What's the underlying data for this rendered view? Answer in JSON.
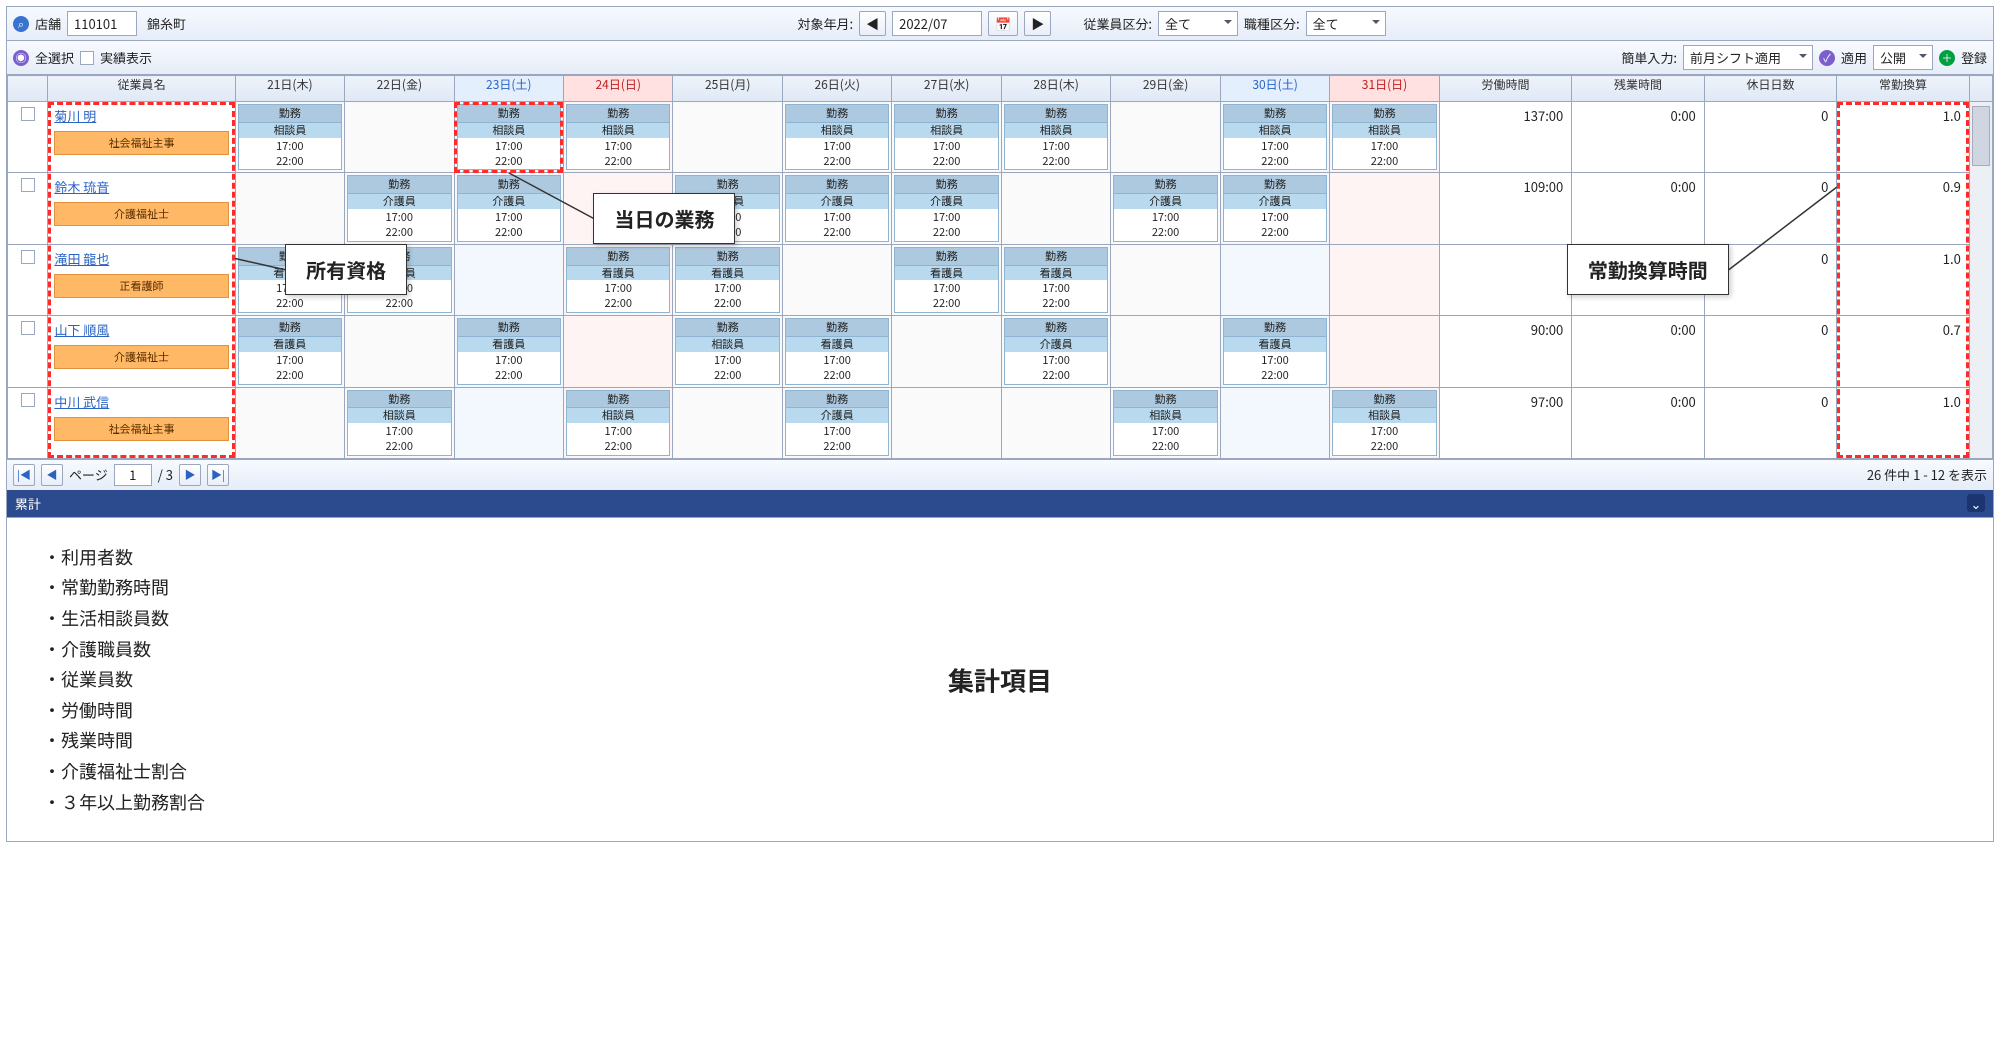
{
  "toolbar1": {
    "store_label": "店舗",
    "store_code": "110101",
    "store_name": "錦糸町",
    "date_label": "対象年月:",
    "date_value": "2022/07",
    "emp_cat_label": "従業員区分:",
    "emp_cat_value": "全て",
    "job_cat_label": "職種区分:",
    "job_cat_value": "全て"
  },
  "toolbar2": {
    "select_all": "全選択",
    "show_actual": "実績表示",
    "easy_label": "簡単入力:",
    "easy_value": "前月シフト適用",
    "apply": "適用",
    "publish": "公開",
    "register": "登録"
  },
  "headers": {
    "emp": "従業員名",
    "work": "労働時間",
    "ot": "残業時間",
    "hol": "休日日数",
    "conv": "常勤換算",
    "days": [
      {
        "l": "21日(木)",
        "c": ""
      },
      {
        "l": "22日(金)",
        "c": ""
      },
      {
        "l": "23日(土)",
        "c": "sat"
      },
      {
        "l": "24日(日)",
        "c": "sun"
      },
      {
        "l": "25日(月)",
        "c": ""
      },
      {
        "l": "26日(火)",
        "c": ""
      },
      {
        "l": "27日(水)",
        "c": ""
      },
      {
        "l": "28日(木)",
        "c": ""
      },
      {
        "l": "29日(金)",
        "c": ""
      },
      {
        "l": "30日(土)",
        "c": "sat"
      },
      {
        "l": "31日(日)",
        "c": "sun"
      }
    ]
  },
  "rows": [
    {
      "name": "菊川 明",
      "qual": "社会福祉主事",
      "work": "137:00",
      "ot": "0:00",
      "hol": "0",
      "conv": "1.0",
      "cells": [
        {
          "h": "勤務",
          "r": "相談員",
          "t1": "17:00",
          "t2": "22:00"
        },
        null,
        {
          "h": "勤務",
          "r": "相談員",
          "t1": "17:00",
          "t2": "22:00"
        },
        {
          "h": "勤務",
          "r": "相談員",
          "t1": "17:00",
          "t2": "22:00"
        },
        null,
        {
          "h": "勤務",
          "r": "相談員",
          "t1": "17:00",
          "t2": "22:00"
        },
        {
          "h": "勤務",
          "r": "相談員",
          "t1": "17:00",
          "t2": "22:00"
        },
        {
          "h": "勤務",
          "r": "相談員",
          "t1": "17:00",
          "t2": "22:00"
        },
        null,
        {
          "h": "勤務",
          "r": "相談員",
          "t1": "17:00",
          "t2": "22:00"
        },
        {
          "h": "勤務",
          "r": "相談員",
          "t1": "17:00",
          "t2": "22:00"
        }
      ]
    },
    {
      "name": "鈴木 琉音",
      "qual": "介護福祉士",
      "work": "109:00",
      "ot": "0:00",
      "hol": "0",
      "conv": "0.9",
      "cells": [
        null,
        {
          "h": "勤務",
          "r": "介護員",
          "t1": "17:00",
          "t2": "22:00"
        },
        {
          "h": "勤務",
          "r": "介護員",
          "t1": "17:00",
          "t2": "22:00"
        },
        null,
        {
          "h": "勤務",
          "r": "介護員",
          "t1": "17:00",
          "t2": "22:00"
        },
        {
          "h": "勤務",
          "r": "介護員",
          "t1": "17:00",
          "t2": "22:00"
        },
        {
          "h": "勤務",
          "r": "介護員",
          "t1": "17:00",
          "t2": "22:00"
        },
        null,
        {
          "h": "勤務",
          "r": "介護員",
          "t1": "17:00",
          "t2": "22:00"
        },
        {
          "h": "勤務",
          "r": "介護員",
          "t1": "17:00",
          "t2": "22:00"
        },
        null
      ]
    },
    {
      "name": "滝田 龍也",
      "qual": "正看護師",
      "work": "",
      "ot": "",
      "hol": "0",
      "conv": "1.0",
      "cells": [
        {
          "h": "勤務",
          "r": "看護員",
          "t1": "17:00",
          "t2": "22:00"
        },
        {
          "h": "勤務",
          "r": "看護員",
          "t1": "17:00",
          "t2": "22:00"
        },
        null,
        {
          "h": "勤務",
          "r": "看護員",
          "t1": "17:00",
          "t2": "22:00"
        },
        {
          "h": "勤務",
          "r": "看護員",
          "t1": "17:00",
          "t2": "22:00"
        },
        null,
        {
          "h": "勤務",
          "r": "看護員",
          "t1": "17:00",
          "t2": "22:00"
        },
        {
          "h": "勤務",
          "r": "看護員",
          "t1": "17:00",
          "t2": "22:00"
        },
        null,
        null,
        null
      ]
    },
    {
      "name": "山下 順風",
      "qual": "介護福祉士",
      "work": "90:00",
      "ot": "0:00",
      "hol": "0",
      "conv": "0.7",
      "cells": [
        {
          "h": "勤務",
          "r": "看護員",
          "t1": "17:00",
          "t2": "22:00"
        },
        null,
        {
          "h": "勤務",
          "r": "看護員",
          "t1": "17:00",
          "t2": "22:00"
        },
        null,
        {
          "h": "勤務",
          "r": "相談員",
          "t1": "17:00",
          "t2": "22:00"
        },
        {
          "h": "勤務",
          "r": "看護員",
          "t1": "17:00",
          "t2": "22:00"
        },
        null,
        {
          "h": "勤務",
          "r": "介護員",
          "t1": "17:00",
          "t2": "22:00"
        },
        null,
        {
          "h": "勤務",
          "r": "看護員",
          "t1": "17:00",
          "t2": "22:00"
        },
        null
      ]
    },
    {
      "name": "中川 武信",
      "qual": "社会福祉主事",
      "work": "97:00",
      "ot": "0:00",
      "hol": "0",
      "conv": "1.0",
      "cells": [
        null,
        {
          "h": "勤務",
          "r": "相談員",
          "t1": "17:00",
          "t2": "22:00"
        },
        null,
        {
          "h": "勤務",
          "r": "相談員",
          "t1": "17:00",
          "t2": "22:00"
        },
        null,
        {
          "h": "勤務",
          "r": "介護員",
          "t1": "17:00",
          "t2": "22:00"
        },
        null,
        null,
        {
          "h": "勤務",
          "r": "相談員",
          "t1": "17:00",
          "t2": "22:00"
        },
        null,
        {
          "h": "勤務",
          "r": "相談員",
          "t1": "17:00",
          "t2": "22:00"
        }
      ]
    }
  ],
  "pager": {
    "page_label": "ページ",
    "page": "1",
    "total": "/ 3",
    "status": "26 件中 1 - 12 を表示"
  },
  "summary": {
    "title": "累計",
    "items": [
      "利用者数",
      "常勤勤務時間",
      "生活相談員数",
      "介護職員数",
      "従業員数",
      "労働時間",
      "残業時間",
      "介護福祉士割合",
      "３年以上勤務割合"
    ],
    "callout": "集計項目"
  },
  "annotations": {
    "qual": "所有資格",
    "day": "当日の業務",
    "conv": "常勤換算時間"
  }
}
